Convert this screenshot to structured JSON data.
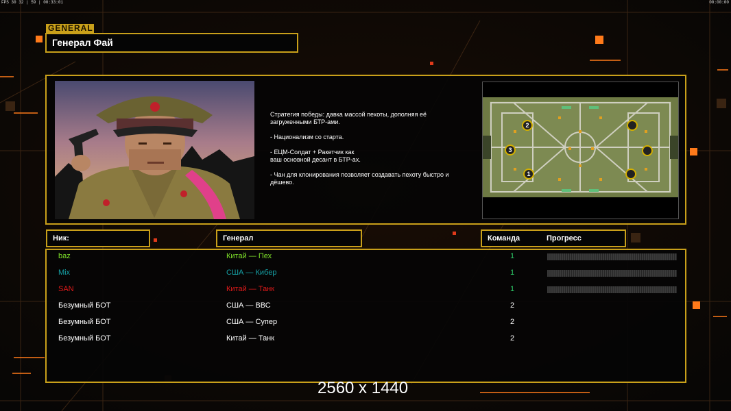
{
  "topbar": {
    "left": "FPS 30 32 | 59 | 00:33:01",
    "right": "00:00:00"
  },
  "general": {
    "tag": "GENERAL",
    "name": "Генерал Фай",
    "description": [
      "Стратегия победы: давка массой пехоты, дополняя её\n загруженными БТР-ами.",
      "- Национализм со старта.",
      "- ЕЦМ-Солдат + Ракетчик как\nваш основной десант в БТР-ах.",
      "- Чан для клонирования позволяет создавать пехоту быстро и\n дёшево."
    ]
  },
  "map": {
    "slots": [
      "2",
      "3",
      "1"
    ]
  },
  "headers": {
    "nick": "Ник:",
    "general": "Генерал",
    "team": "Команда",
    "progress": "Прогресс"
  },
  "players": [
    {
      "nick": "baz",
      "general": "Китай — Пех",
      "team": "1",
      "color": "#7ee02a",
      "progress": true
    },
    {
      "nick": "Mix",
      "general": "США — Кибер",
      "team": "1",
      "color": "#16a3a8",
      "progress": true
    },
    {
      "nick": "SAN",
      "general": "Китай — Танк",
      "team": "1",
      "color": "#e01a1a",
      "progress": true
    },
    {
      "nick": "Безумный БОТ",
      "general": "США — ВВС",
      "team": "2",
      "color": "#ffffff",
      "progress": false
    },
    {
      "nick": "Безумный БОТ",
      "general": "США — Супер",
      "team": "2",
      "color": "#ffffff",
      "progress": false
    },
    {
      "nick": "Безумный БОТ",
      "general": "Китай — Танк",
      "team": "2",
      "color": "#ffffff",
      "progress": false
    }
  ],
  "watermark": "2560 x 1440",
  "colors": {
    "accent": "#c9a01a",
    "orange": "#ff7a1a"
  }
}
